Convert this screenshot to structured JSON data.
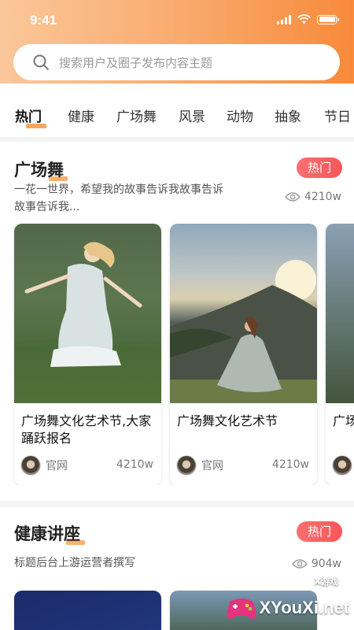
{
  "status": {
    "time": "9:41"
  },
  "search": {
    "placeholder": "搜索用户及圈子发布内容主题"
  },
  "tabs": [
    {
      "label": "热门",
      "active": true
    },
    {
      "label": "健康"
    },
    {
      "label": "广场舞"
    },
    {
      "label": "风景"
    },
    {
      "label": "动物"
    },
    {
      "label": "抽象"
    },
    {
      "label": "节日"
    }
  ],
  "sections": [
    {
      "title": "广场舞",
      "badge": "热门",
      "description_line1": "一花一世界，希望我的故事告诉我故事告诉",
      "description_line2": "故事告诉我...",
      "views": "4210w",
      "cards": [
        {
          "title": "广场舞文化艺术节,大家踊跃报名",
          "author": "官网",
          "count": "4210w"
        },
        {
          "title": "广场舞文化艺术节",
          "author": "官网",
          "count": "4210w"
        },
        {
          "title": "广场",
          "author": "",
          "count": ""
        }
      ]
    },
    {
      "title": "健康讲座",
      "badge": "热门",
      "description_line1": "标题后台上游运营者撰写",
      "views": "904w"
    }
  ],
  "watermark": {
    "logo_text": "XYouXi.net",
    "small_text": "X游戏"
  },
  "colors": {
    "accent": "#f8953f",
    "badge": "#f8575a",
    "header_start": "#fbc79a",
    "header_end": "#f88a3a"
  }
}
